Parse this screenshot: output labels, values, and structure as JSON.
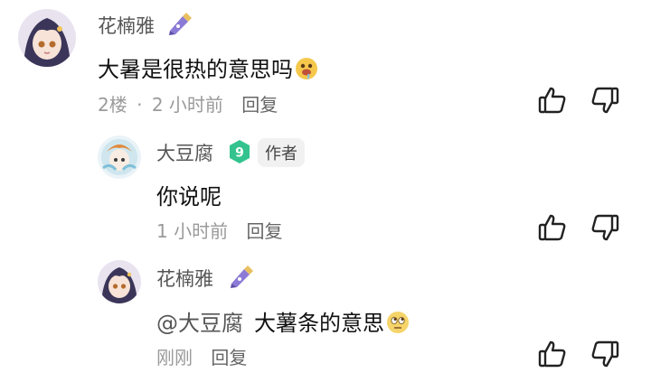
{
  "comments": [
    {
      "username": "花楠雅",
      "badge_icon": "game-character-badge",
      "text": "大暑是很热的意思吗",
      "emoji_icon": "drooling-face-emoji",
      "floor": "2楼",
      "separator": "·",
      "time": "2 小时前",
      "reply_label": "回复"
    },
    {
      "username": "大豆腐",
      "level_badge": "9",
      "author_tag": "作者",
      "text": "你说呢",
      "time": "1 小时前",
      "reply_label": "回复"
    },
    {
      "username": "花楠雅",
      "badge_icon": "game-character-badge",
      "mention": "@大豆腐",
      "text": "大薯条的意思",
      "emoji_icon": "rolling-eyes-face-emoji",
      "time": "刚刚",
      "reply_label": "回复"
    }
  ],
  "colors": {
    "level_badge": "#34c38f",
    "username": "#555555",
    "meta": "#9a9a9a"
  }
}
